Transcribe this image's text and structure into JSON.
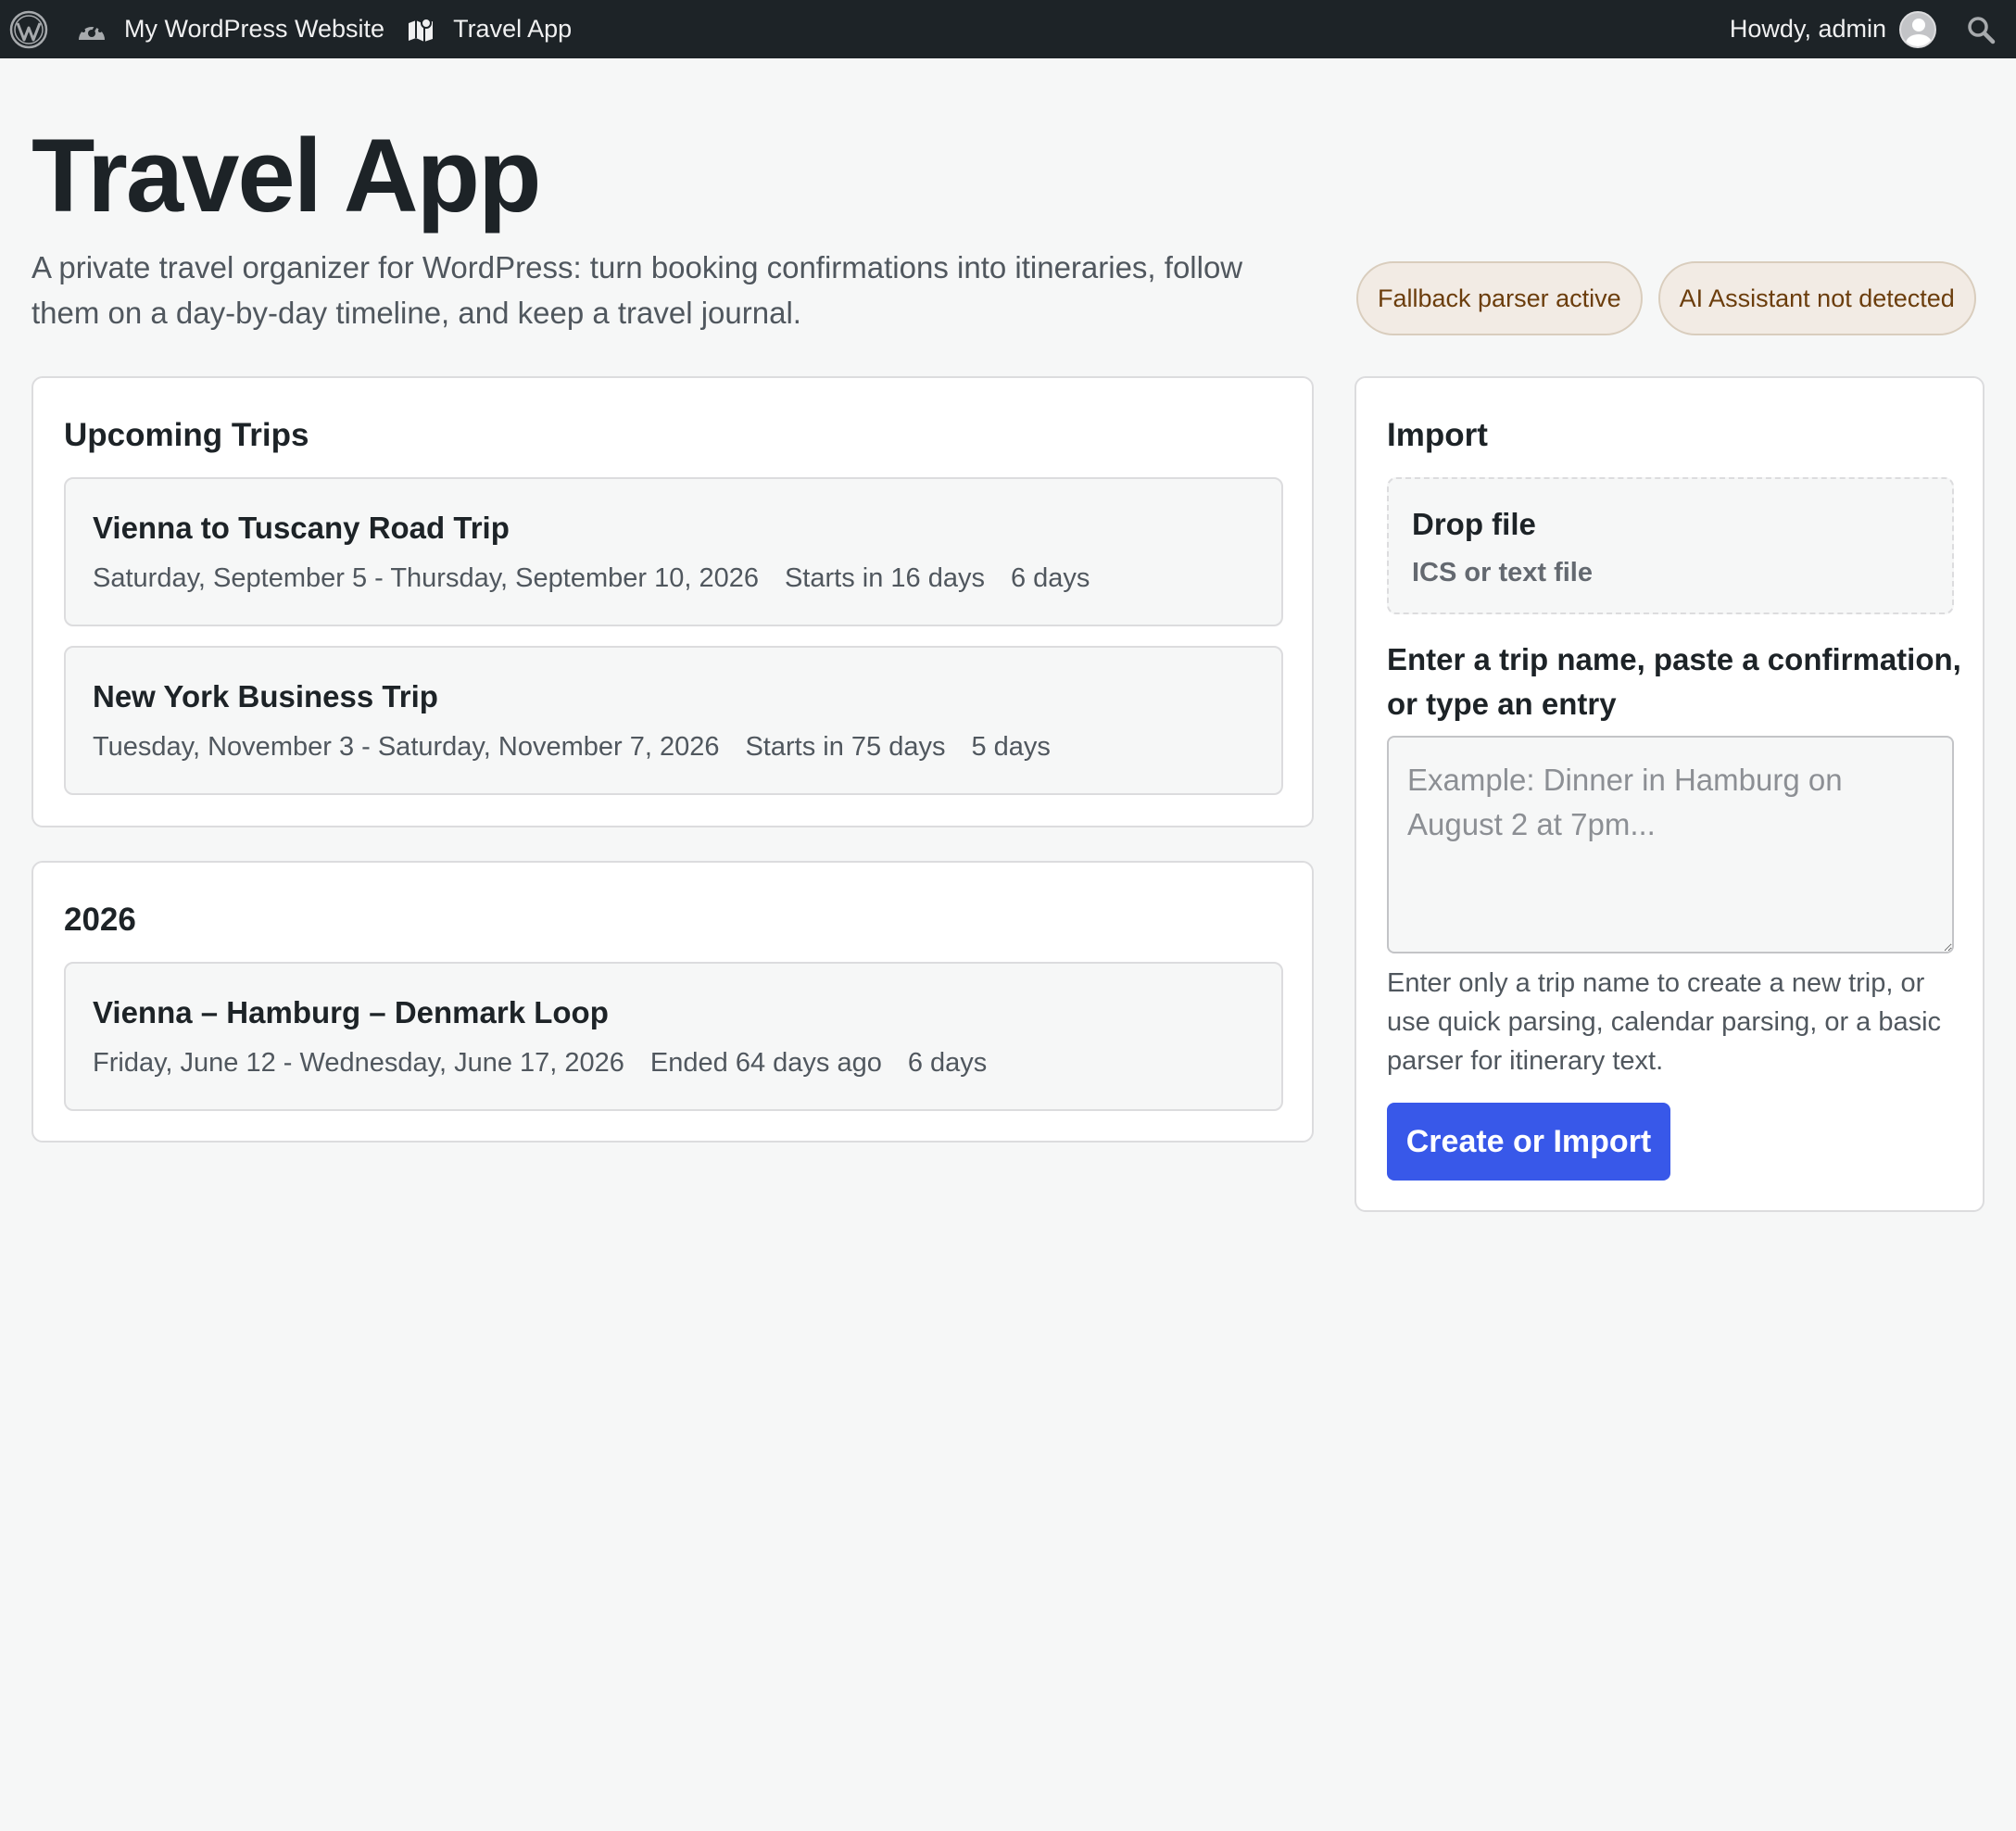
{
  "adminbar": {
    "site_name": "My WordPress Website",
    "app_link": "Travel App",
    "greeting": "Howdy, admin"
  },
  "header": {
    "title": "Travel App",
    "intro": "A private travel organizer for WordPress: turn booking confirmations into itineraries, follow them on a day-by-day timeline, and keep a travel journal.",
    "badges": [
      "Fallback parser active",
      "AI Assistant not detected"
    ]
  },
  "upcoming": {
    "heading": "Upcoming Trips",
    "trips": [
      {
        "name": "Vienna to Tuscany Road Trip",
        "dates": "Saturday, September 5 - Thursday, September 10, 2026",
        "status": "Starts in 16 days",
        "duration": "6 days"
      },
      {
        "name": "New York Business Trip",
        "dates": "Tuesday, November 3 - Saturday, November 7, 2026",
        "status": "Starts in 75 days",
        "duration": "5 days"
      }
    ]
  },
  "archive": {
    "heading": "2026",
    "trips": [
      {
        "name": "Vienna – Hamburg – Denmark Loop",
        "dates": "Friday, June 12 - Wednesday, June 17, 2026",
        "status": "Ended 64 days ago",
        "duration": "6 days"
      }
    ]
  },
  "import": {
    "heading": "Import",
    "drop_title": "Drop file",
    "drop_subtitle": "ICS or text file",
    "label": "Enter a trip name, paste a confirmation, or type an entry",
    "placeholder": "Example: Dinner in Hamburg on August 2 at 7pm...",
    "value": "",
    "help": "Enter only a trip name to create a new trip, or use quick parsing, calendar parsing, or a basic parser for itinerary text.",
    "button": "Create or Import"
  },
  "colors": {
    "adminbar": "#1d2327",
    "primary_button": "#3858e9",
    "badge_bg": "#f2ebe4",
    "badge_text": "#6b3d0c"
  }
}
